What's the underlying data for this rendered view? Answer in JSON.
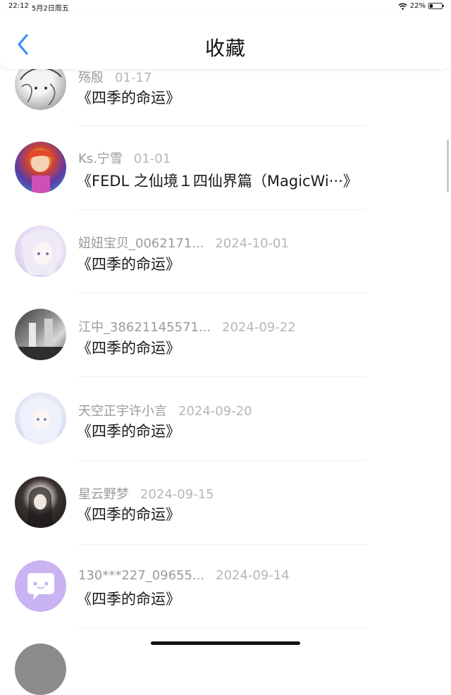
{
  "status_bar": {
    "time": "22:12",
    "date": "5月2日周五",
    "battery": "22%"
  },
  "header": {
    "title": "收藏"
  },
  "items": [
    {
      "user": "殇殷",
      "date": "01-17",
      "title": "《四季的命运》"
    },
    {
      "user": "Ks.宁雪",
      "date": "01-01",
      "title": "《FEDL 之仙境１四仙界篇（MagicWi···》"
    },
    {
      "user": "妞妞宝贝_0062171...",
      "date": "2024-10-01",
      "title": "《四季的命运》"
    },
    {
      "user": "江中_38621145571...",
      "date": "2024-09-22",
      "title": "《四季的命运》"
    },
    {
      "user": "天空正宇许小言",
      "date": "2024-09-20",
      "title": "《四季的命运》"
    },
    {
      "user": "星云野梦",
      "date": "2024-09-15",
      "title": "《四季的命运》"
    },
    {
      "user": "130***227_09655...",
      "date": "2024-09-14",
      "title": "《四季的命运》"
    }
  ],
  "colors": {
    "accent": "#3a8ef6",
    "text_primary": "#1a1a1a",
    "text_secondary": "#9a9a9a",
    "default_avatar": "#c9b3f2"
  }
}
